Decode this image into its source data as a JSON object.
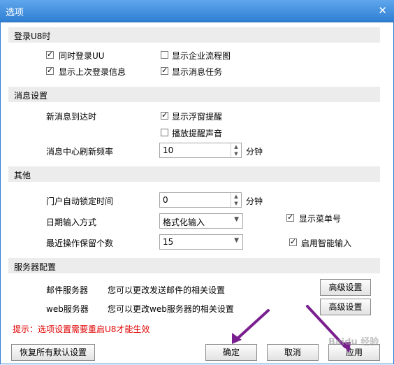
{
  "window": {
    "title": "选项"
  },
  "sections": {
    "login": "登录U8时",
    "message": "消息设置",
    "other": "其他",
    "server": "服务器配置"
  },
  "login": {
    "simultaneous": {
      "label": "同时登录UU",
      "checked": true
    },
    "show_flow": {
      "label": "显示企业流程图",
      "checked": false
    },
    "show_last_login": {
      "label": "显示上次登录信息",
      "checked": true
    },
    "show_tasks": {
      "label": "显示消息任务",
      "checked": true
    }
  },
  "message": {
    "arrival_label": "新消息到达时",
    "show_popup": {
      "label": "显示浮窗提醒",
      "checked": true
    },
    "play_sound": {
      "label": "播放提醒声音",
      "checked": false
    },
    "refresh_label": "消息中心刷新频率",
    "refresh_value": "10",
    "refresh_unit": "分钟"
  },
  "other": {
    "autolock_label": "门户自动锁定时间",
    "autolock_value": "0",
    "autolock_unit": "分钟",
    "date_input_label": "日期输入方式",
    "date_input_value": "格式化输入",
    "show_menu_no": {
      "label": "显示菜单号",
      "checked": true
    },
    "recent_ops_label": "最近操作保留个数",
    "recent_ops_value": "15",
    "smart_input": {
      "label": "启用智能输入",
      "checked": true
    }
  },
  "server": {
    "mail_label": "邮件服务器",
    "mail_desc": "您可以更改发送邮件的相关设置",
    "web_label": "web服务器",
    "web_desc": "您可以更改web服务器的相关设置",
    "advanced_label": "高级设置"
  },
  "hint": "提示：选项设置需要重启U8才能生效",
  "buttons": {
    "restore": "恢复所有默认设置",
    "ok": "确定",
    "cancel": "取消",
    "apply": "应用"
  },
  "watermark": "Baidu 经验",
  "colors": {
    "titlebar": "#2f7fd3",
    "hint": "#e00000",
    "arrow": "#7a1f8f"
  }
}
